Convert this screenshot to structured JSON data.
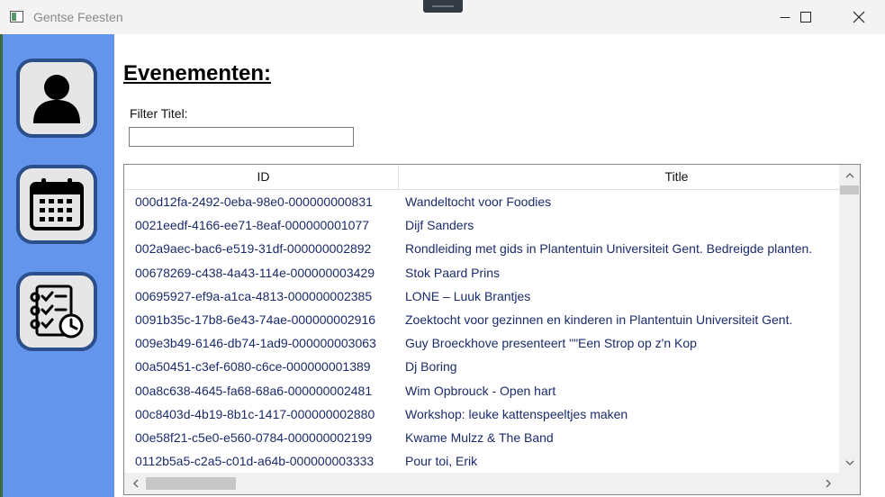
{
  "window": {
    "title": "Gentse Feesten",
    "controls": [
      "minimize-icon",
      "maximize-icon",
      "close-icon"
    ]
  },
  "sidebar": {
    "items": [
      {
        "name": "profile",
        "icon": "user-icon"
      },
      {
        "name": "calendar",
        "icon": "calendar-icon"
      },
      {
        "name": "tasks",
        "icon": "checklist-clock-icon"
      }
    ]
  },
  "main": {
    "heading": "Evenementen:",
    "filter": {
      "label": "Filter Titel:",
      "value": "",
      "placeholder": ""
    },
    "table": {
      "columns": [
        "ID",
        "Title"
      ],
      "rows": [
        {
          "id": "000d12fa-2492-0eba-98e0-000000000831",
          "title": "Wandeltocht voor Foodies"
        },
        {
          "id": "0021eedf-4166-ee71-8eaf-000000001077",
          "title": "Dijf Sanders"
        },
        {
          "id": "002a9aec-bac6-e519-31df-000000002892",
          "title": "Rondleiding met gids in Plantentuin Universiteit Gent. Bedreigde planten."
        },
        {
          "id": "00678269-c438-4a43-114e-000000003429",
          "title": "Stok Paard Prins"
        },
        {
          "id": "00695927-ef9a-a1ca-4813-000000002385",
          "title": "LONE – Luuk Brantjes"
        },
        {
          "id": "0091b35c-17b8-6e43-74ae-000000002916",
          "title": "Zoektocht voor gezinnen en kinderen in Plantentuin Universiteit Gent."
        },
        {
          "id": "009e3b49-6146-db74-1ad9-000000003063",
          "title": "Guy Broeckhove presenteert \"\"Een Strop op z'n Kop"
        },
        {
          "id": "00a50451-c3ef-6080-c6ce-000000001389",
          "title": "Dj Boring"
        },
        {
          "id": "00a8c638-4645-fa68-68a6-000000002481",
          "title": "Wim Opbrouck - Open hart"
        },
        {
          "id": "00c8403d-4b19-8b1c-1417-000000002880",
          "title": "Workshop: leuke kattenspeeltjes maken"
        },
        {
          "id": "00e58f21-c5e0-e560-0784-000000002199",
          "title": "Kwame Mulzz & The Band"
        },
        {
          "id": "0112b5a5-c2a5-c01d-a64b-000000003333",
          "title": "Pour toi, Erik"
        }
      ]
    }
  },
  "colors": {
    "sidebar": "#6495ed",
    "nav_button_border": "#2b4f8a",
    "nav_button_fill": "#e6e6e6",
    "cell_text": "#1a2b6b"
  }
}
